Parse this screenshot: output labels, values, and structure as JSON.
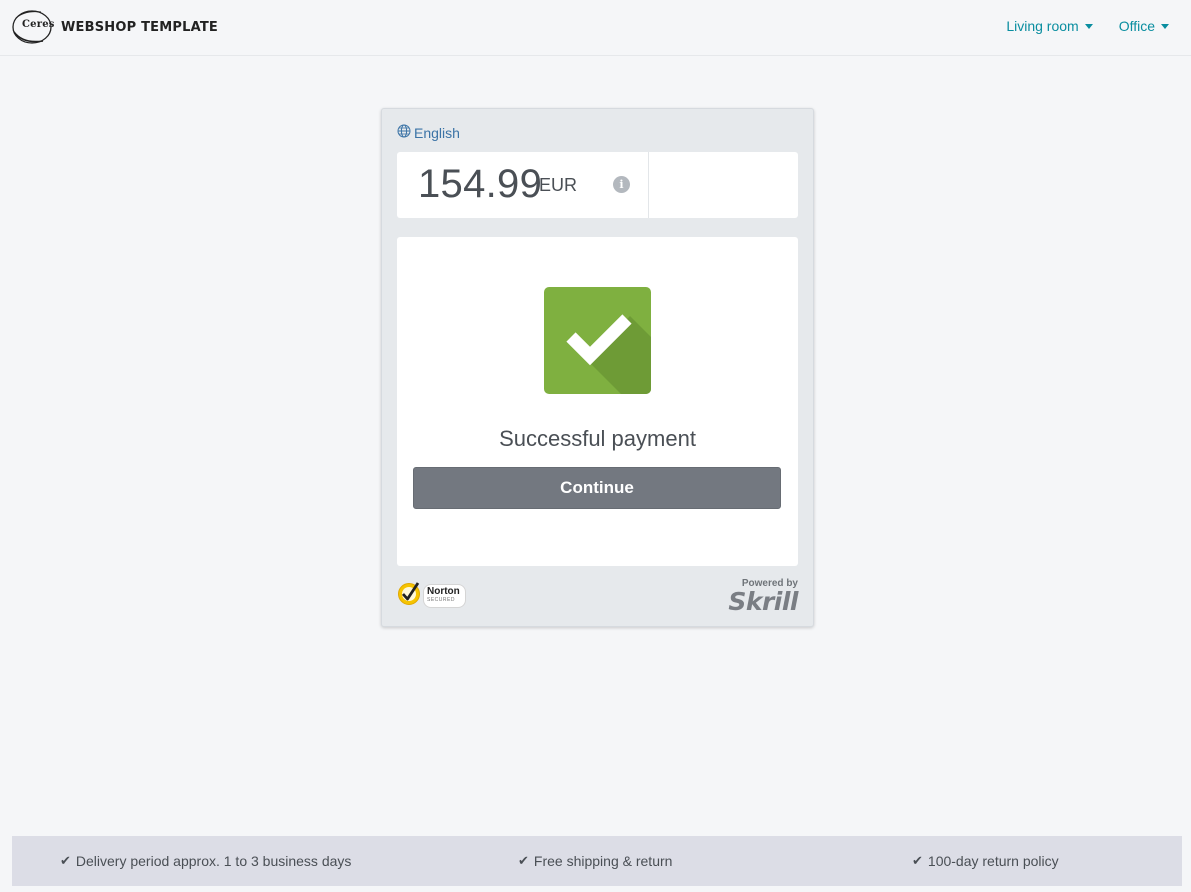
{
  "header": {
    "logo_text": "Ceres",
    "brand_title": "WEBSHOP TEMPLATE",
    "nav": [
      {
        "label": "Living room"
      },
      {
        "label": "Office"
      }
    ]
  },
  "payment": {
    "language": "English",
    "amount": "154.99",
    "currency": "EUR",
    "info_icon_glyph": "i",
    "status": "Successful payment",
    "continue_label": "Continue",
    "norton_name": "Norton",
    "norton_sub": "SECURED",
    "powered_by": "Powered by",
    "provider": "Skrill",
    "colors": {
      "success_green": "#7fb040",
      "button_gray": "#737880",
      "link_blue": "#3b73a6",
      "nav_teal": "#0a8ea0"
    }
  },
  "footer": {
    "items": [
      {
        "label": "Delivery period approx. 1 to 3 business days"
      },
      {
        "label": "Free shipping & return"
      },
      {
        "label": "100-day return policy"
      }
    ]
  }
}
